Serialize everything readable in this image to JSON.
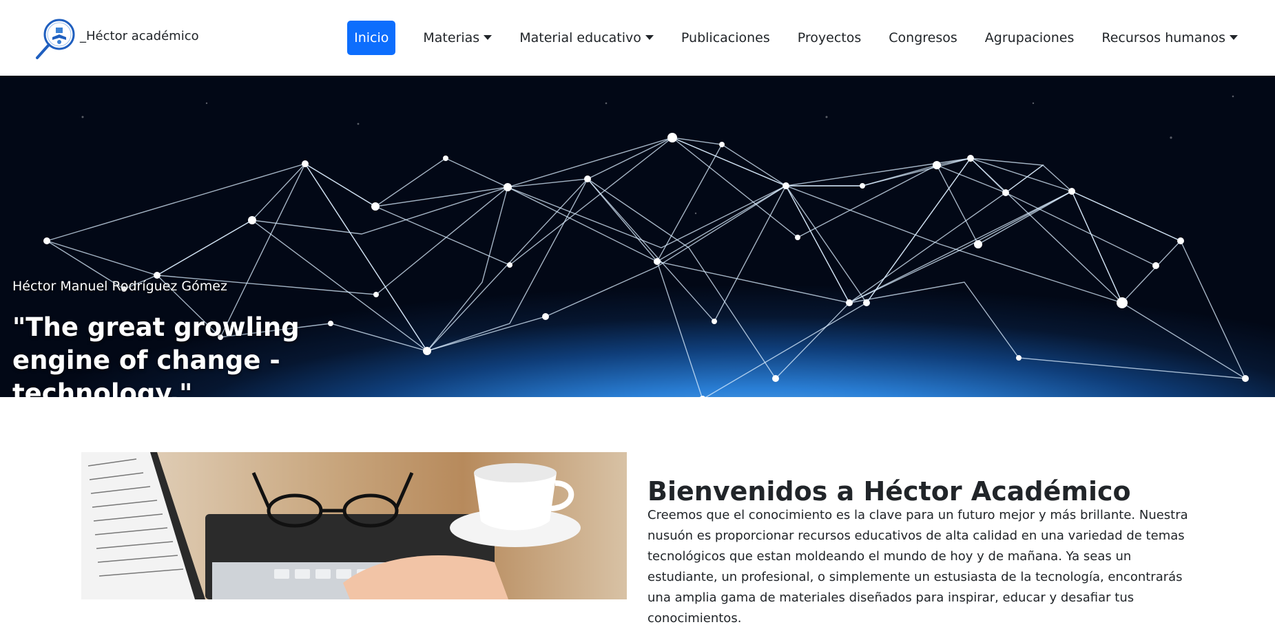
{
  "brand": {
    "name": "_Héctor académico",
    "logo_icon": "magnifier-book-logo"
  },
  "nav": {
    "items": [
      {
        "label": "Inicio",
        "active": true,
        "dropdown": false
      },
      {
        "label": "Materias",
        "active": false,
        "dropdown": true
      },
      {
        "label": "Material educativo",
        "active": false,
        "dropdown": true
      },
      {
        "label": "Publicaciones",
        "active": false,
        "dropdown": false
      },
      {
        "label": "Proyectos",
        "active": false,
        "dropdown": false
      },
      {
        "label": "Congresos",
        "active": false,
        "dropdown": false
      },
      {
        "label": "Agrupaciones",
        "active": false,
        "dropdown": false
      },
      {
        "label": "Recursos humanos",
        "active": false,
        "dropdown": true
      }
    ],
    "active_color": "#0d6efd"
  },
  "hero": {
    "author": "Héctor Manuel Rodríguez Gómez",
    "quote": "\"The great growling engine of change - technology.\""
  },
  "welcome": {
    "title": "Bienvenidos a Héctor Académico",
    "text": "Creemos que el conocimiento es la clave para un futuro mejor y más brillante. Nuestra nusuón es proporcionar recursos educativos de alta calidad en una variedad de temas tecnológicos que estan moldeando el mundo de hoy y de mañana. Ya seas un estudiante, un profesional, o simplemente un estusiasta de la tecnología, encontrarás una amplia gama de materiales diseñados para inspirar, educar y desafiar tus conocimientos."
  }
}
